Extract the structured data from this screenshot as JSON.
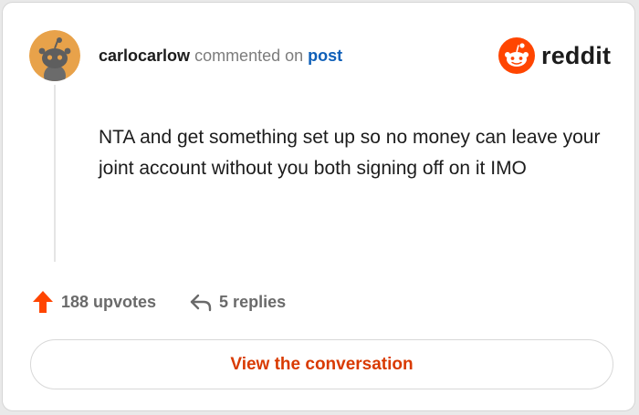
{
  "comment_card": {
    "username": "carlocarlow",
    "action_text": "commented on",
    "post_link_label": "post",
    "brand_name": "reddit",
    "comment_body": "NTA and get something set up so no money can leave your joint account without you both signing off on it IMO",
    "upvotes_label": "188 upvotes",
    "replies_label": "5 replies",
    "cta_label": "View the conversation"
  },
  "icons": {
    "avatar": "snoo-avatar-icon",
    "brand": "reddit-logo-icon",
    "upvote": "arrow-up-icon",
    "replies": "reply-arrow-icon"
  },
  "colors": {
    "brand_orange": "#ff4500",
    "cta_text": "#d93a00",
    "link_blue": "#0e5fb8",
    "avatar_bg": "#e8a24a"
  }
}
